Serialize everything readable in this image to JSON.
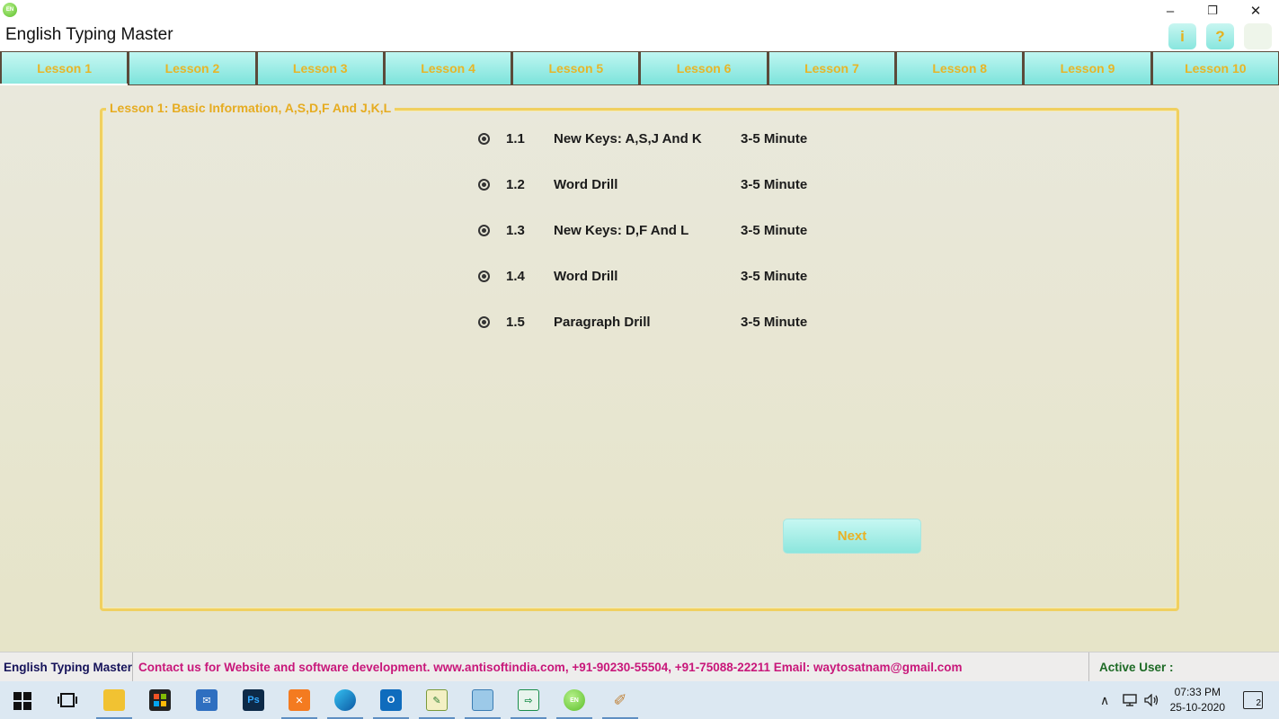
{
  "window": {
    "title": "English Typing Master",
    "logo_text": "EN",
    "controls": {
      "minimize": "–",
      "restore": "❐",
      "close": "✕"
    }
  },
  "header_icons": [
    {
      "name": "info-icon",
      "glyph": "i"
    },
    {
      "name": "help-icon",
      "glyph": "?"
    },
    {
      "name": "settings-icon",
      "glyph": ""
    }
  ],
  "tabs": [
    {
      "label": "Lesson 1",
      "active": true
    },
    {
      "label": "Lesson 2"
    },
    {
      "label": "Lesson 3"
    },
    {
      "label": "Lesson 4"
    },
    {
      "label": "Lesson 5"
    },
    {
      "label": "Lesson 6"
    },
    {
      "label": "Lesson 7"
    },
    {
      "label": "Lesson 8"
    },
    {
      "label": "Lesson 9"
    },
    {
      "label": "Lesson 10"
    }
  ],
  "lesson": {
    "legend": "Lesson 1: Basic Information, A,S,D,F And J,K,L",
    "items": [
      {
        "num": "1.1",
        "name": "New Keys: A,S,J And K",
        "duration": "3-5 Minute"
      },
      {
        "num": "1.2",
        "name": "Word Drill",
        "duration": "3-5 Minute"
      },
      {
        "num": "1.3",
        "name": "New Keys: D,F And L",
        "duration": "3-5 Minute"
      },
      {
        "num": "1.4",
        "name": "Word Drill",
        "duration": "3-5 Minute"
      },
      {
        "num": "1.5",
        "name": "Paragraph Drill",
        "duration": "3-5 Minute"
      }
    ],
    "next_label": "Next"
  },
  "status": {
    "app_name": "English Typing Master",
    "contact": "Contact us for Website and software development. www.antisoftindia.com, +91-90230-55504, +91-75088-22211  Email: waytosatnam@gmail.com",
    "active_user": "Active User :"
  },
  "taskbar": {
    "time": "07:33 PM",
    "date": "25-10-2020",
    "notifications": "2"
  }
}
